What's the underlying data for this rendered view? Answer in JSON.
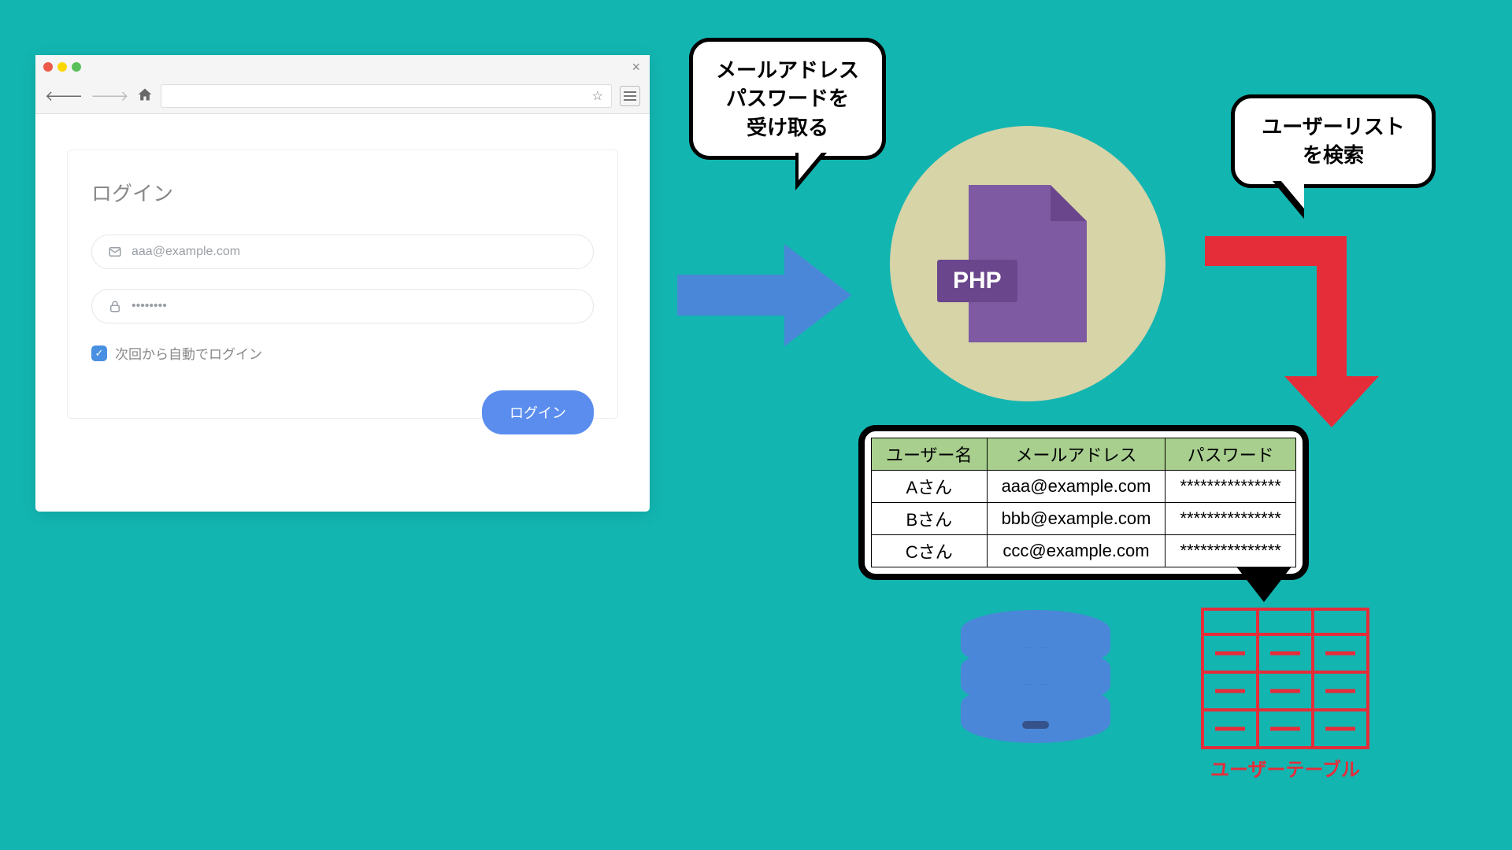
{
  "login_form": {
    "title": "ログイン",
    "email_placeholder": "aaa@example.com",
    "password_placeholder": "••••••••",
    "remember_label": "次回から自動でログイン",
    "submit_label": "ログイン"
  },
  "bubbles": {
    "receive": "メールアドレス\nパスワードを\n受け取る",
    "search": "ユーザーリスト\nを検索"
  },
  "php_label": "PHP",
  "user_table": {
    "headers": [
      "ユーザー名",
      "メールアドレス",
      "パスワード"
    ],
    "rows": [
      [
        "Aさん",
        "aaa@example.com",
        "***************"
      ],
      [
        "Bさん",
        "bbb@example.com",
        "***************"
      ],
      [
        "Cさん",
        "ccc@example.com",
        "***************"
      ]
    ]
  },
  "table_icon_label": "ユーザーテーブル",
  "colors": {
    "bg": "#13b5b1",
    "blue": "#4a87d8",
    "red": "#e52d3a",
    "purple": "#7e5aa2",
    "green_header": "#a8cf8e"
  }
}
